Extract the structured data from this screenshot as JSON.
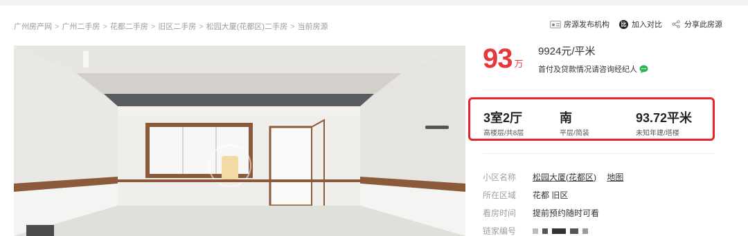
{
  "breadcrumb": [
    "广州房产网",
    "广州二手房",
    "花都二手房",
    "旧区二手房",
    "松园大厦(花都区)二手房",
    "当前房源"
  ],
  "actions": {
    "publisher": "房源发布机构",
    "compare": "加入对比",
    "compare_icon_text": "比",
    "share": "分享此房源"
  },
  "price": {
    "total": "93",
    "unit": "万",
    "unit_price": "9924元/平米",
    "note": "首付及贷款情况请咨询经纪人"
  },
  "specs": [
    {
      "main": "3室2厅",
      "sub": "高楼层/共8层"
    },
    {
      "main": "南",
      "sub": "平层/简装"
    },
    {
      "main": "93.72平米",
      "sub": "未知年建/塔楼"
    }
  ],
  "info": {
    "community_label": "小区名称",
    "community_value": "松园大厦(花都区)",
    "map_label": "地图",
    "area_label": "所在区域",
    "area_value": "花都 旧区",
    "viewing_label": "看房时间",
    "viewing_value": "提前预约随时可看",
    "code_label": "链家编号"
  },
  "colors": {
    "price_red": "#e4393c",
    "highlight_red": "#e8242a",
    "chat_green": "#2bb24c"
  }
}
